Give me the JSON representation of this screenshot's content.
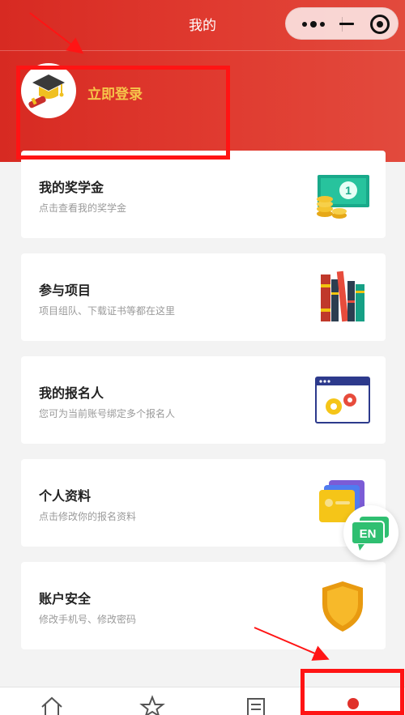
{
  "header": {
    "title": "我的",
    "bg_color": "#d72a22",
    "capsule_icons": [
      "more-dots-icon",
      "minimize-icon",
      "target-close-icon"
    ]
  },
  "profile": {
    "login_label": "立即登录",
    "login_color": "#f6c54a",
    "avatar_icon": "graduation-cap-icon"
  },
  "cards": [
    {
      "title": "我的奖学金",
      "subtitle": "点击查看我的奖学金",
      "icon": "money-coins-icon"
    },
    {
      "title": "参与项目",
      "subtitle": "项目组队、下载证书等都在这里",
      "icon": "books-icon"
    },
    {
      "title": "我的报名人",
      "subtitle": "您可为当前账号绑定多个报名人",
      "icon": "browser-gears-icon"
    },
    {
      "title": "个人资料",
      "subtitle": "点击修改你的报名资料",
      "icon": "profile-stack-icon"
    },
    {
      "title": "账户安全",
      "subtitle": "修改手机号、修改密码",
      "icon": "shield-icon"
    }
  ],
  "floating": {
    "language_label": "EN",
    "color": "#2fbf71"
  },
  "tabbar": {
    "tabs": [
      {
        "icon": "home-icon",
        "active": false
      },
      {
        "icon": "star-icon",
        "active": false
      },
      {
        "icon": "list-document-icon",
        "active": false
      },
      {
        "icon": "person-icon",
        "active": true
      }
    ],
    "active_color": "#e0312a",
    "inactive_color": "#555555"
  },
  "annotation_color": "#ff1414"
}
